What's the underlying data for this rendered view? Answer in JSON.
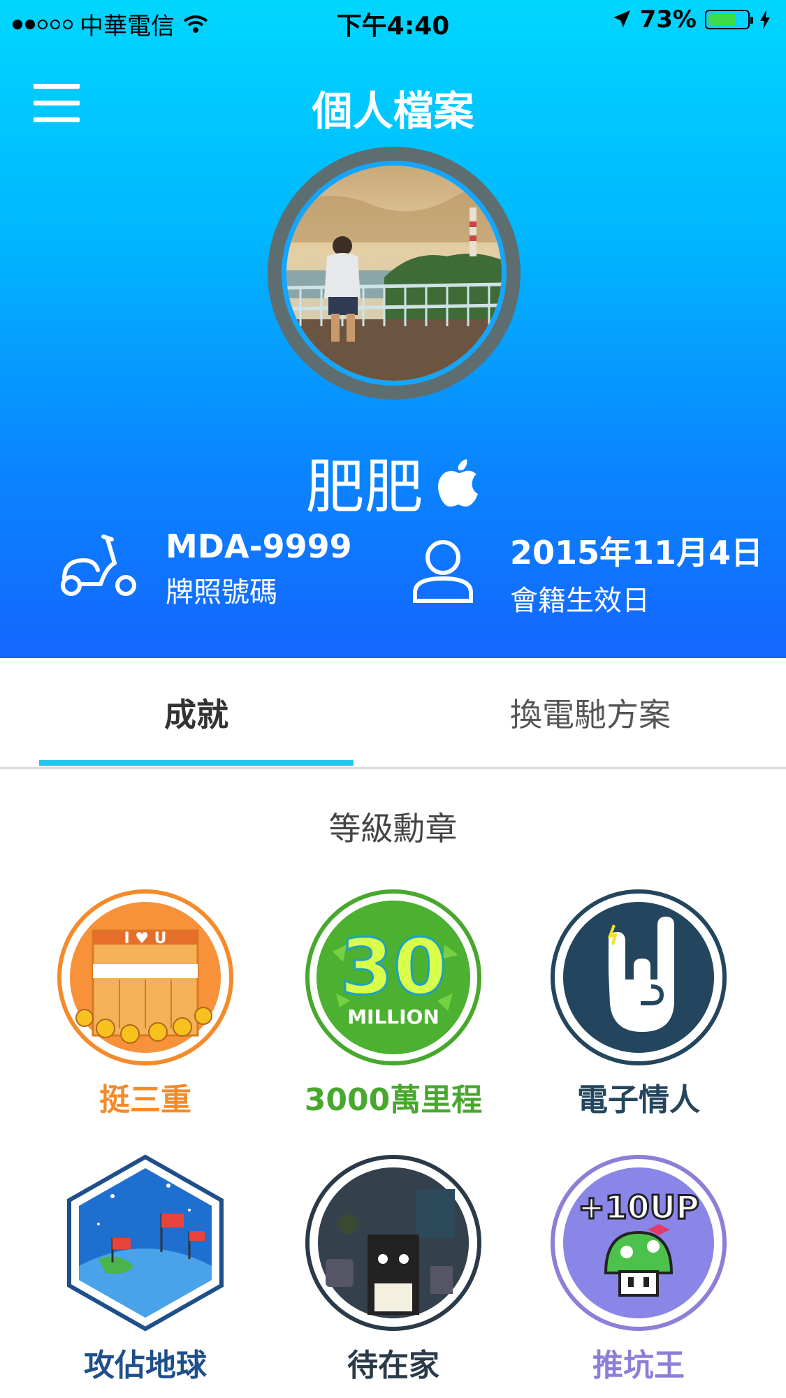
{
  "status_bar": {
    "carrier": "中華電信",
    "time": "下午4:40",
    "battery": "73%",
    "battery_level": 0.73
  },
  "header": {
    "title": "個人檔案",
    "user_name": "肥肥"
  },
  "info": {
    "plate": {
      "value": "MDA-9999",
      "label": "牌照號碼"
    },
    "member": {
      "value": "2015年11月4日",
      "label": "會籍生效日"
    }
  },
  "tabs": [
    {
      "label": "成就",
      "active": true
    },
    {
      "label": "換電馳方案",
      "active": false
    }
  ],
  "section": {
    "title": "等級勳章"
  },
  "badges": [
    {
      "label": "挺三重",
      "color": "#f58a2a",
      "icon": "storefront-sunflower-badge-icon",
      "artwork_text": "I ♥ U"
    },
    {
      "label": "3000萬里程",
      "color": "#48a82d",
      "icon": "30-million-badge-icon",
      "artwork_text": [
        "30",
        "MILLION"
      ]
    },
    {
      "label": "電子情人",
      "color": "#23465e",
      "icon": "rock-hand-badge-icon"
    },
    {
      "label": "攻佔地球",
      "color": "#1e4f8a",
      "icon": "globe-flags-badge-icon"
    },
    {
      "label": "待在家",
      "color": "#2a3a48",
      "icon": "stay-home-badge-icon"
    },
    {
      "label": "推坑王",
      "color": "#8e7ed8",
      "icon": "mushroom-10up-badge-icon",
      "artwork_text": "+10UP"
    }
  ]
}
